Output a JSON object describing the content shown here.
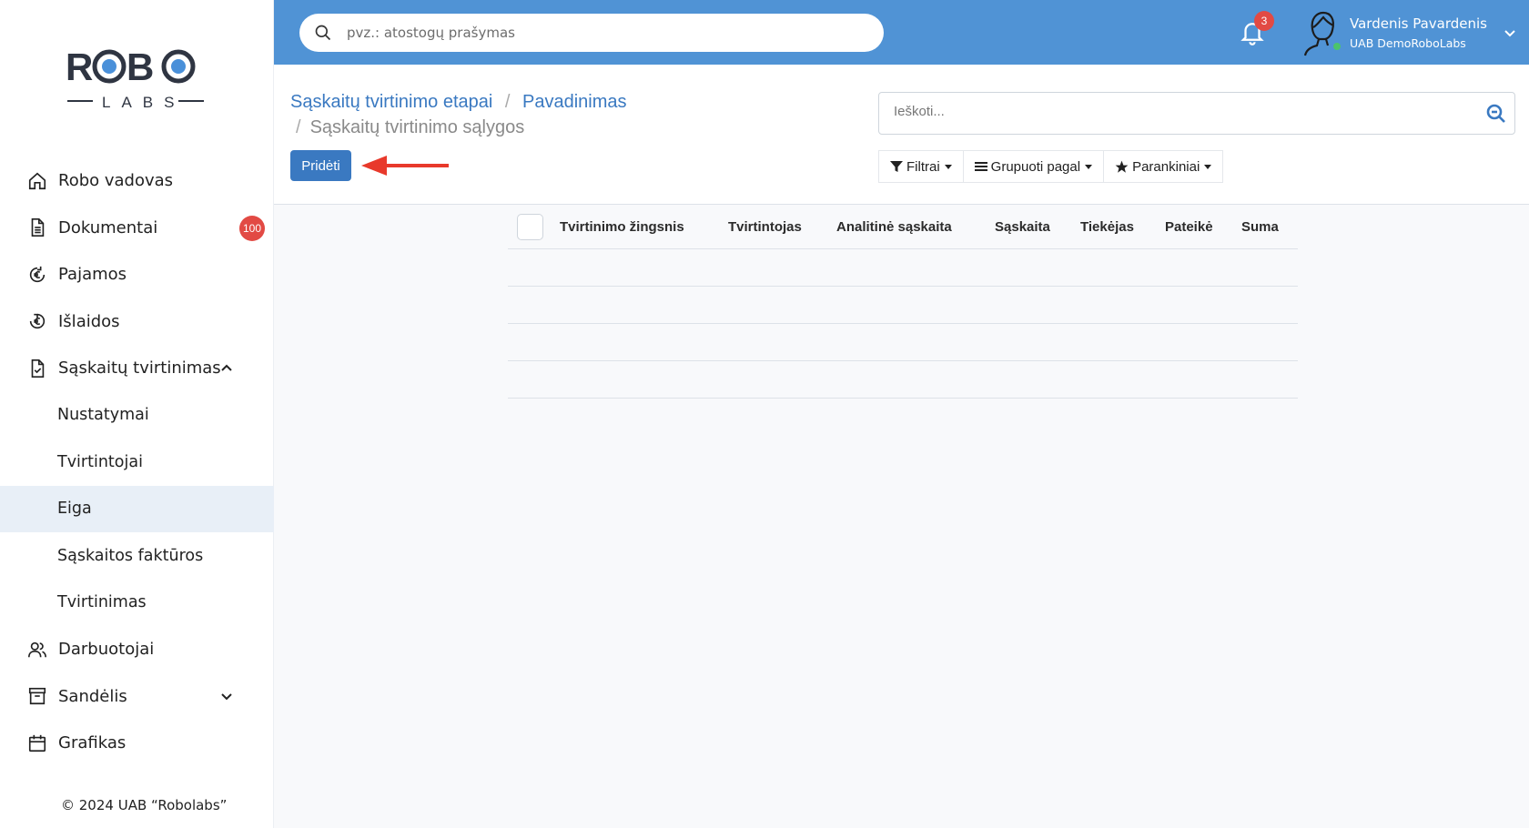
{
  "logo": {
    "top": "ROBO",
    "bottom": "LABS"
  },
  "sidebar": {
    "items": [
      {
        "label": "Robo vadovas",
        "icon": "home-icon"
      },
      {
        "label": "Dokumentai",
        "icon": "document-icon",
        "badge": "100"
      },
      {
        "label": "Pajamos",
        "icon": "euro-income-icon"
      },
      {
        "label": "Išlaidos",
        "icon": "euro-expense-icon"
      },
      {
        "label": "Sąskaitų tvirtinimas",
        "icon": "invoice-check-icon",
        "expanded": true
      },
      {
        "label": "Nustatymai"
      },
      {
        "label": "Tvirtintojai"
      },
      {
        "label": "Eiga",
        "active": true
      },
      {
        "label": "Sąskaitos faktūros"
      },
      {
        "label": "Tvirtinimas"
      },
      {
        "label": "Darbuotojai",
        "icon": "users-icon"
      },
      {
        "label": "Sandėlis",
        "icon": "archive-icon",
        "expanded": false
      },
      {
        "label": "Grafikas",
        "icon": "calendar-icon"
      }
    ],
    "copyright": "© 2024 UAB “Robolabs”"
  },
  "header": {
    "search_placeholder": "pvz.: atostogų prašymas",
    "notifications_count": "3",
    "user_name": "Vardenis Pavardenis",
    "user_company": "UAB DemoRoboLabs",
    "accent_color": "#5093d5"
  },
  "control": {
    "breadcrumb": [
      "Sąskaitų tvirtinimo etapai",
      "Pavadinimas",
      "Sąskaitų tvirtinimo sąlygos"
    ],
    "add_button": "Pridėti",
    "search_placeholder": "Ieškoti...",
    "filters_label": "Filtrai",
    "group_label": "Grupuoti pagal",
    "favorites_label": "Parankiniai"
  },
  "table": {
    "columns": [
      "Tvirtinimo žingsnis",
      "Tvirtintojas",
      "Analitinė sąskaita",
      "Sąskaita",
      "Tiekėjas",
      "Pateikė",
      "Suma"
    ],
    "rows": []
  }
}
